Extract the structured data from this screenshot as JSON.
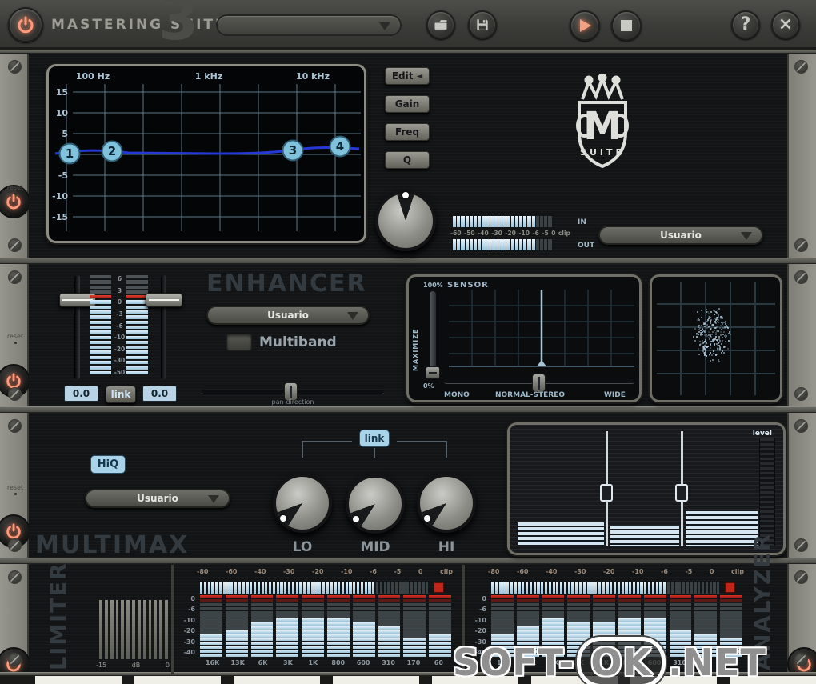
{
  "titlebar": {
    "title": "MASTERING SUITE",
    "version": "3",
    "preset": "",
    "help": "?",
    "close": "×"
  },
  "rail": {
    "reset_label": "reset"
  },
  "presets": {
    "eq": "Usuario",
    "enhancer": "Usuario",
    "multimax": "Usuario"
  },
  "eq": {
    "buttons": [
      "Edit",
      "Gain",
      "Freq",
      "Q"
    ],
    "freq_labels": [
      "100 Hz",
      "1 kHz",
      "10 kHz"
    ],
    "gain_labels": [
      "15",
      "10",
      "5",
      "-5",
      "-10",
      "-15"
    ],
    "handles": [
      "1",
      "2",
      "3",
      "4"
    ],
    "meter_scale": [
      "-60",
      "-50",
      "-40",
      "-30",
      "-20",
      "-10",
      "-6",
      "-5",
      "0",
      "clip"
    ],
    "in_label": "IN",
    "out_label": "OUT",
    "in_meter": {
      "segments": 24,
      "lit": 20
    },
    "out_meter": {
      "segments": 24,
      "lit": 20
    },
    "logo_letter": "M",
    "logo_sub": "SUITE"
  },
  "enhancer": {
    "title": "ENHANCER",
    "scale": [
      "6",
      "3",
      "0",
      "-3",
      "-6",
      "-10",
      "-20",
      "-30",
      "-50"
    ],
    "left_value": "0.0",
    "right_value": "0.0",
    "link_label": "link",
    "multiband_label": "Multiband",
    "pan_label": "pan-direction",
    "meter": {
      "rows": 20,
      "dim_rows": 4,
      "red_rows": 1
    },
    "sensor": {
      "top_pct": "100%",
      "title": "SENSOR",
      "maximize": "MAXIMIZE",
      "bottom_pct": "0%",
      "mono": "MONO",
      "normal": "NORMAL-STEREO",
      "wide": "WIDE"
    }
  },
  "multimax": {
    "title": "MULTIMAX",
    "hiq": "HiQ",
    "link": "link",
    "knobs": [
      "LO",
      "MID",
      "HI"
    ],
    "level_label": "level",
    "level_bars": [
      0.2,
      0.17,
      0.29
    ]
  },
  "limiter": {
    "title": "LIMITER",
    "scale": [
      "-15",
      "dB",
      "0"
    ],
    "bars": 13
  },
  "analyzer": {
    "title": "ANALYZER",
    "top_scale": [
      "-80",
      "-60",
      "-40",
      "-30",
      "-20",
      "-10",
      "-6",
      "-5",
      "0",
      "clip"
    ],
    "db_scale": [
      "0",
      "-6",
      "-10",
      "-20",
      "-30",
      "-40"
    ],
    "bands": [
      "16K",
      "13K",
      "6K",
      "3K",
      "1K",
      "800",
      "600",
      "310",
      "170",
      "60"
    ],
    "left_values": [
      6,
      7,
      9,
      10,
      10,
      10,
      9,
      8,
      5,
      6
    ],
    "right_values": [
      6,
      8,
      10,
      9,
      9,
      10,
      10,
      7,
      6,
      5
    ],
    "segments_per_column": 16,
    "led": {
      "segments": 60,
      "lit": 46
    }
  },
  "watermark": {
    "part1": "SOFT-",
    "part2": "OK",
    "part3": ".NET"
  }
}
